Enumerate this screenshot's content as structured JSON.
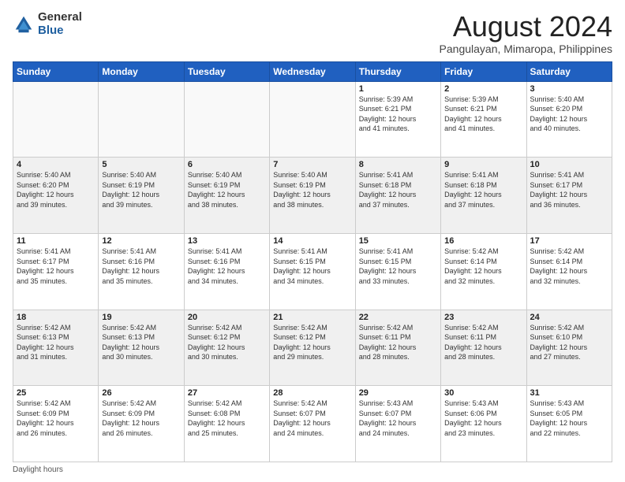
{
  "logo": {
    "general": "General",
    "blue": "Blue"
  },
  "title": "August 2024",
  "subtitle": "Pangulayan, Mimaropa, Philippines",
  "days_of_week": [
    "Sunday",
    "Monday",
    "Tuesday",
    "Wednesday",
    "Thursday",
    "Friday",
    "Saturday"
  ],
  "footer_label": "Daylight hours",
  "weeks": [
    [
      {
        "day": "",
        "info": ""
      },
      {
        "day": "",
        "info": ""
      },
      {
        "day": "",
        "info": ""
      },
      {
        "day": "",
        "info": ""
      },
      {
        "day": "1",
        "info": "Sunrise: 5:39 AM\nSunset: 6:21 PM\nDaylight: 12 hours\nand 41 minutes."
      },
      {
        "day": "2",
        "info": "Sunrise: 5:39 AM\nSunset: 6:21 PM\nDaylight: 12 hours\nand 41 minutes."
      },
      {
        "day": "3",
        "info": "Sunrise: 5:40 AM\nSunset: 6:20 PM\nDaylight: 12 hours\nand 40 minutes."
      }
    ],
    [
      {
        "day": "4",
        "info": "Sunrise: 5:40 AM\nSunset: 6:20 PM\nDaylight: 12 hours\nand 39 minutes."
      },
      {
        "day": "5",
        "info": "Sunrise: 5:40 AM\nSunset: 6:19 PM\nDaylight: 12 hours\nand 39 minutes."
      },
      {
        "day": "6",
        "info": "Sunrise: 5:40 AM\nSunset: 6:19 PM\nDaylight: 12 hours\nand 38 minutes."
      },
      {
        "day": "7",
        "info": "Sunrise: 5:40 AM\nSunset: 6:19 PM\nDaylight: 12 hours\nand 38 minutes."
      },
      {
        "day": "8",
        "info": "Sunrise: 5:41 AM\nSunset: 6:18 PM\nDaylight: 12 hours\nand 37 minutes."
      },
      {
        "day": "9",
        "info": "Sunrise: 5:41 AM\nSunset: 6:18 PM\nDaylight: 12 hours\nand 37 minutes."
      },
      {
        "day": "10",
        "info": "Sunrise: 5:41 AM\nSunset: 6:17 PM\nDaylight: 12 hours\nand 36 minutes."
      }
    ],
    [
      {
        "day": "11",
        "info": "Sunrise: 5:41 AM\nSunset: 6:17 PM\nDaylight: 12 hours\nand 35 minutes."
      },
      {
        "day": "12",
        "info": "Sunrise: 5:41 AM\nSunset: 6:16 PM\nDaylight: 12 hours\nand 35 minutes."
      },
      {
        "day": "13",
        "info": "Sunrise: 5:41 AM\nSunset: 6:16 PM\nDaylight: 12 hours\nand 34 minutes."
      },
      {
        "day": "14",
        "info": "Sunrise: 5:41 AM\nSunset: 6:15 PM\nDaylight: 12 hours\nand 34 minutes."
      },
      {
        "day": "15",
        "info": "Sunrise: 5:41 AM\nSunset: 6:15 PM\nDaylight: 12 hours\nand 33 minutes."
      },
      {
        "day": "16",
        "info": "Sunrise: 5:42 AM\nSunset: 6:14 PM\nDaylight: 12 hours\nand 32 minutes."
      },
      {
        "day": "17",
        "info": "Sunrise: 5:42 AM\nSunset: 6:14 PM\nDaylight: 12 hours\nand 32 minutes."
      }
    ],
    [
      {
        "day": "18",
        "info": "Sunrise: 5:42 AM\nSunset: 6:13 PM\nDaylight: 12 hours\nand 31 minutes."
      },
      {
        "day": "19",
        "info": "Sunrise: 5:42 AM\nSunset: 6:13 PM\nDaylight: 12 hours\nand 30 minutes."
      },
      {
        "day": "20",
        "info": "Sunrise: 5:42 AM\nSunset: 6:12 PM\nDaylight: 12 hours\nand 30 minutes."
      },
      {
        "day": "21",
        "info": "Sunrise: 5:42 AM\nSunset: 6:12 PM\nDaylight: 12 hours\nand 29 minutes."
      },
      {
        "day": "22",
        "info": "Sunrise: 5:42 AM\nSunset: 6:11 PM\nDaylight: 12 hours\nand 28 minutes."
      },
      {
        "day": "23",
        "info": "Sunrise: 5:42 AM\nSunset: 6:11 PM\nDaylight: 12 hours\nand 28 minutes."
      },
      {
        "day": "24",
        "info": "Sunrise: 5:42 AM\nSunset: 6:10 PM\nDaylight: 12 hours\nand 27 minutes."
      }
    ],
    [
      {
        "day": "25",
        "info": "Sunrise: 5:42 AM\nSunset: 6:09 PM\nDaylight: 12 hours\nand 26 minutes."
      },
      {
        "day": "26",
        "info": "Sunrise: 5:42 AM\nSunset: 6:09 PM\nDaylight: 12 hours\nand 26 minutes."
      },
      {
        "day": "27",
        "info": "Sunrise: 5:42 AM\nSunset: 6:08 PM\nDaylight: 12 hours\nand 25 minutes."
      },
      {
        "day": "28",
        "info": "Sunrise: 5:42 AM\nSunset: 6:07 PM\nDaylight: 12 hours\nand 24 minutes."
      },
      {
        "day": "29",
        "info": "Sunrise: 5:43 AM\nSunset: 6:07 PM\nDaylight: 12 hours\nand 24 minutes."
      },
      {
        "day": "30",
        "info": "Sunrise: 5:43 AM\nSunset: 6:06 PM\nDaylight: 12 hours\nand 23 minutes."
      },
      {
        "day": "31",
        "info": "Sunrise: 5:43 AM\nSunset: 6:05 PM\nDaylight: 12 hours\nand 22 minutes."
      }
    ]
  ]
}
